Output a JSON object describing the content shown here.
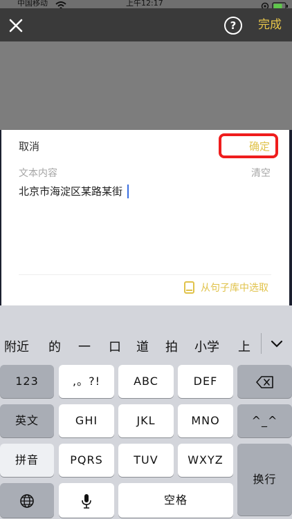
{
  "status_bar": {
    "carrier": "中国移动",
    "time": "上午12:17"
  },
  "top_bar": {
    "close_icon": "close-icon",
    "help_icon": "help-icon",
    "done_label": "完成"
  },
  "sheet": {
    "cancel_label": "取消",
    "confirm_label": "确定",
    "text_label": "文本内容",
    "clear_label": "清空",
    "text_value": "北京市海淀区某路某街",
    "library_label": "从句子库中选取"
  },
  "keyboard": {
    "candidates": [
      "附近",
      "的",
      "一",
      "口",
      "道",
      "拍",
      "小学",
      "上"
    ],
    "keys": {
      "k123": "123",
      "punct": ",。?!",
      "abc": "ABC",
      "def": "DEF",
      "english": "英文",
      "ghi": "GHI",
      "jkl": "JKL",
      "mno": "MNO",
      "emoticon": "^_^",
      "pinyin": "拼音",
      "pqrs": "PQRS",
      "tuv": "TUV",
      "wxyz": "WXYZ",
      "enter": "换行",
      "space": "空格"
    }
  },
  "colors": {
    "accent": "#e0c24a",
    "highlight": "#ef1d1d",
    "caret": "#3a6fe0"
  }
}
